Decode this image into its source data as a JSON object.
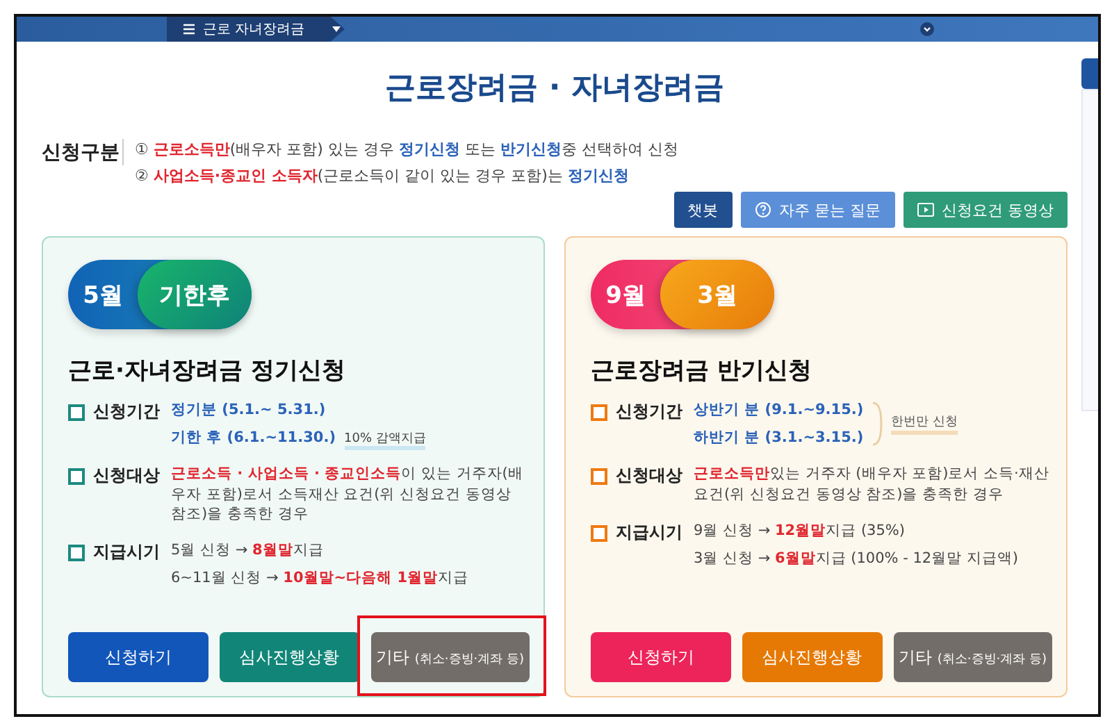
{
  "nav": {
    "label": "근로 자녀장려금"
  },
  "title": "근로장려금 · 자녀장려금",
  "application_types": {
    "label": "신청구분",
    "items": [
      {
        "marker": "①",
        "segments": [
          {
            "text": "근로소득만",
            "kind": "red"
          },
          {
            "text": "(배우자 포함) 있는 경우 ",
            "kind": "plain"
          },
          {
            "text": "정기신청",
            "kind": "blue"
          },
          {
            "text": " 또는 ",
            "kind": "plain"
          },
          {
            "text": "반기신청",
            "kind": "blue"
          },
          {
            "text": "중 선택하여 신청",
            "kind": "plain"
          }
        ]
      },
      {
        "marker": "②",
        "segments": [
          {
            "text": "사업소득·종교인 소득자",
            "kind": "red"
          },
          {
            "text": "(근로소득이 같이 있는 경우 포함)는 ",
            "kind": "plain"
          },
          {
            "text": "정기신청",
            "kind": "blue"
          }
        ]
      }
    ]
  },
  "top_buttons": [
    {
      "label": "챗봇",
      "kind": "chatbot"
    },
    {
      "label": "자주 묻는 질문",
      "kind": "faq"
    },
    {
      "label": "신청요건 동영상",
      "kind": "video"
    }
  ],
  "cards": [
    {
      "kind": "green",
      "pills": [
        "5월",
        "기한후"
      ],
      "title": "근로·자녀장려금 정기신청",
      "rows": [
        {
          "label": "신청기간",
          "lines": [
            [
              {
                "text": "정기분 (5.1.~ 5.31.)",
                "kind": "blue"
              }
            ],
            [
              {
                "text": "기한 후 (6.1.~11.30.)",
                "kind": "blue"
              },
              {
                "text": "10% 감액지급",
                "kind": "tag"
              }
            ]
          ]
        },
        {
          "label": "신청대상",
          "lines": [
            [
              {
                "text": "근로소득 · 사업소득 · 종교인소득",
                "kind": "red"
              },
              {
                "text": "이 있는 거주자(배우자 포함)로서 소득재산 요건(위 신청요건 동영상 참조)을 충족한 경우",
                "kind": "plain"
              }
            ]
          ]
        },
        {
          "label": "지급시기",
          "lines": [
            [
              {
                "text": "5월 신청 → ",
                "kind": "plain"
              },
              {
                "text": "8월말",
                "kind": "red"
              },
              {
                "text": "지급",
                "kind": "plain"
              }
            ],
            [
              {
                "text": "6~11월 신청 → ",
                "kind": "plain"
              },
              {
                "text": "10월말~다음해 1월말",
                "kind": "red"
              },
              {
                "text": "지급",
                "kind": "plain"
              }
            ]
          ]
        }
      ],
      "buttons": [
        {
          "label": "신청하기",
          "kind": "apply",
          "highlighted": false
        },
        {
          "label": "심사진행상황",
          "kind": "status",
          "highlighted": false
        },
        {
          "label": "기타",
          "sub": "(취소·증빙·계좌 등)",
          "kind": "other",
          "highlighted": true
        }
      ]
    },
    {
      "kind": "orange",
      "pills": [
        "9월",
        "3월"
      ],
      "title": "근로장려금 반기신청",
      "rows": [
        {
          "label": "신청기간",
          "lines": [
            [
              {
                "text": "상반기 분 (9.1.~9.15.)",
                "kind": "blue"
              }
            ],
            [
              {
                "text": "하반기 분 (3.1.~3.15.)",
                "kind": "blue"
              }
            ]
          ],
          "note": "한번만 신청"
        },
        {
          "label": "신청대상",
          "lines": [
            [
              {
                "text": "근로소득만",
                "kind": "red"
              },
              {
                "text": "있는 거주자 (배우자 포함)로서 소득·재산 요건(위 신청요건 동영상 참조)을 충족한 경우",
                "kind": "plain"
              }
            ]
          ]
        },
        {
          "label": "지급시기",
          "lines": [
            [
              {
                "text": "9월 신청 → ",
                "kind": "plain"
              },
              {
                "text": "12월말",
                "kind": "red"
              },
              {
                "text": "지급 (35%)",
                "kind": "plain"
              }
            ],
            [
              {
                "text": "3월 신청 → ",
                "kind": "plain"
              },
              {
                "text": "6월말",
                "kind": "red"
              },
              {
                "text": "지급 (100% - 12월말 지급액)",
                "kind": "plain"
              }
            ]
          ]
        }
      ],
      "buttons": [
        {
          "label": "신청하기",
          "kind": "apply",
          "highlighted": false
        },
        {
          "label": "심사진행상황",
          "kind": "status",
          "highlighted": false
        },
        {
          "label": "기타",
          "sub": "(취소·증빙·계좌 등)",
          "kind": "other",
          "highlighted": false
        }
      ]
    }
  ]
}
